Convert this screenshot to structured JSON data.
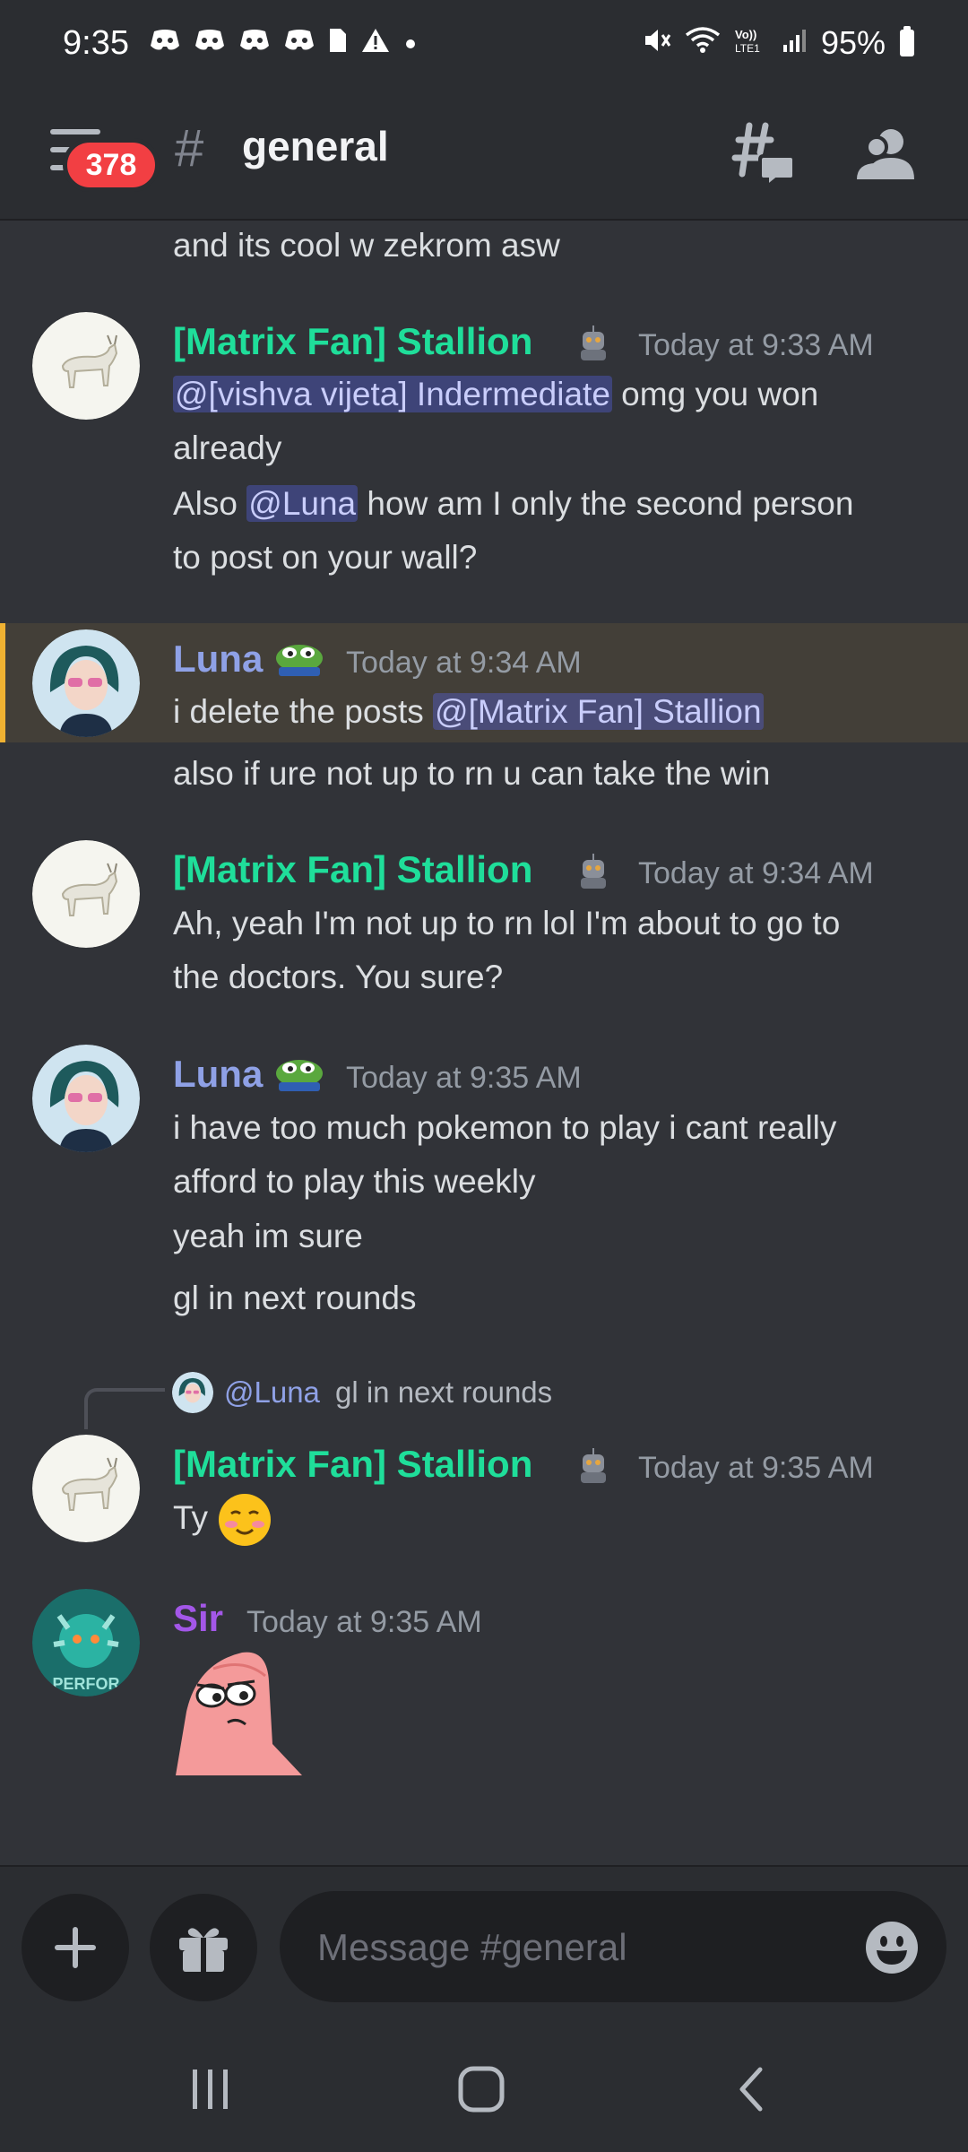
{
  "status_bar": {
    "time": "9:35",
    "notif_icons": [
      "discord-icon",
      "discord-icon",
      "discord-icon",
      "discord-icon",
      "sim-card-icon",
      "warning-icon",
      "dot-icon"
    ],
    "system_icons": [
      "mute-icon",
      "wifi-icon",
      "volte-icon",
      "signal-icon"
    ],
    "battery": "95%"
  },
  "header": {
    "unread_count": "378",
    "channel_name": "general"
  },
  "messages": [
    {
      "continuation_text": "and its cool w zekrom asw"
    },
    {
      "author": "[Matrix Fan] Stallion",
      "timestamp": "Today at 9:33 AM",
      "line1_mention": "@[vishva vijeta] Indermediate",
      "line1_text": " omg you won",
      "line2": "already",
      "line3_pre": "Also ",
      "line3_mention": "@Luna",
      "line3_text": " how am I only the second person",
      "line4": "to post on your wall?"
    },
    {
      "author": "Luna",
      "timestamp": "Today at 9:34 AM",
      "line1_text": "i delete the posts ",
      "line1_mention": "@[Matrix Fan] Stallion",
      "line2": "also if ure not up to rn u can take the win"
    },
    {
      "author": "[Matrix Fan] Stallion",
      "timestamp": "Today at 9:34 AM",
      "line1": "Ah, yeah I'm not up to rn lol I'm about to go to",
      "line2": "the doctors. You sure?"
    },
    {
      "author": "Luna",
      "timestamp": "Today at 9:35 AM",
      "line1": "i have too much pokemon to play i cant really",
      "line2": "afford to play this weekly",
      "line3": "yeah im sure",
      "line4": "gl in next rounds"
    },
    {
      "reply_to_author": "@Luna",
      "reply_to_text": "gl in next rounds",
      "author": "[Matrix Fan] Stallion",
      "timestamp": "Today at 9:35 AM",
      "text": "Ty"
    },
    {
      "author": "Sir",
      "timestamp": "Today at 9:35 AM",
      "sticker": "patrick-star-sticker"
    }
  ],
  "composer": {
    "placeholder": "Message #general"
  },
  "colors": {
    "background": "#313338",
    "bar": "#2b2d31",
    "stallion_name": "#1fde9a",
    "luna_name": "#8fa1e6",
    "sir_name": "#a357e8",
    "mention_highlight": "#f0b232",
    "unread_badge": "#f23f43"
  }
}
